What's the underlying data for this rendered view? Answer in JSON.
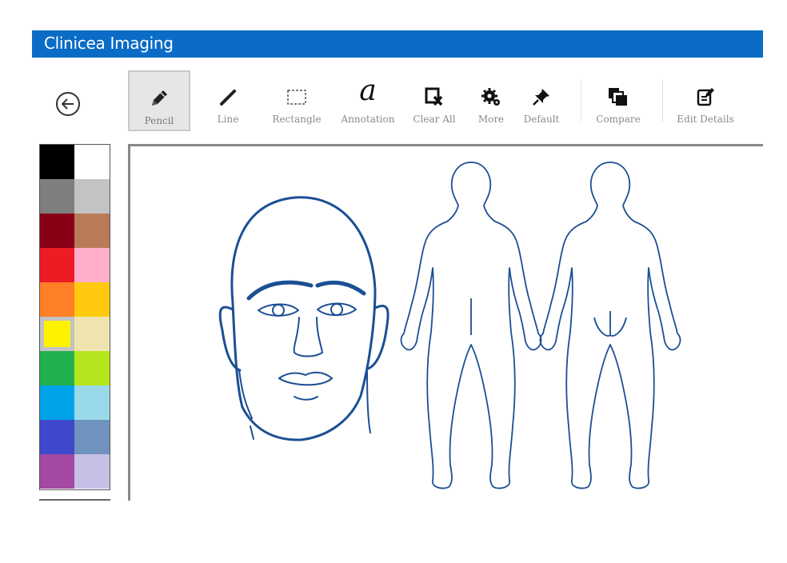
{
  "app": {
    "title": "Clinicea Imaging"
  },
  "nav": {
    "back_icon": "back-arrow-circle-icon"
  },
  "toolbar": {
    "tools": [
      {
        "label": "Pencil",
        "icon": "pencil-icon",
        "active": true
      },
      {
        "label": "Line",
        "icon": "line-icon"
      },
      {
        "label": "Rectangle",
        "icon": "rectangle-select-icon"
      },
      {
        "label": "Annotation",
        "icon": "annotation-icon",
        "glyph": "a"
      },
      {
        "label": "Clear All",
        "icon": "clear-all-icon"
      },
      {
        "label": "More",
        "icon": "gear-more-icon"
      },
      {
        "label": "Default",
        "icon": "pin-icon"
      },
      {
        "label": "Compare",
        "icon": "compare-icon"
      },
      {
        "label": "Edit Details",
        "icon": "edit-details-icon"
      }
    ]
  },
  "palette": {
    "colors": [
      "#000000",
      "#ffffff",
      "#7f7f7f",
      "#c3c3c3",
      "#880015",
      "#b97a57",
      "#ed1c24",
      "#ffaec9",
      "#ff7f27",
      "#ffc90e",
      "#fff200",
      "#efe4b0",
      "#22b14c",
      "#b5e61d",
      "#00a2e8",
      "#99d9ea",
      "#3f48cc",
      "#7092be",
      "#a349a4",
      "#c8bfe7"
    ],
    "selected_index": 10
  },
  "canvas": {
    "template": "face-and-body-outline",
    "stroke_color": "#1c4f94",
    "figures": [
      "face-front",
      "body-front",
      "body-back"
    ]
  }
}
